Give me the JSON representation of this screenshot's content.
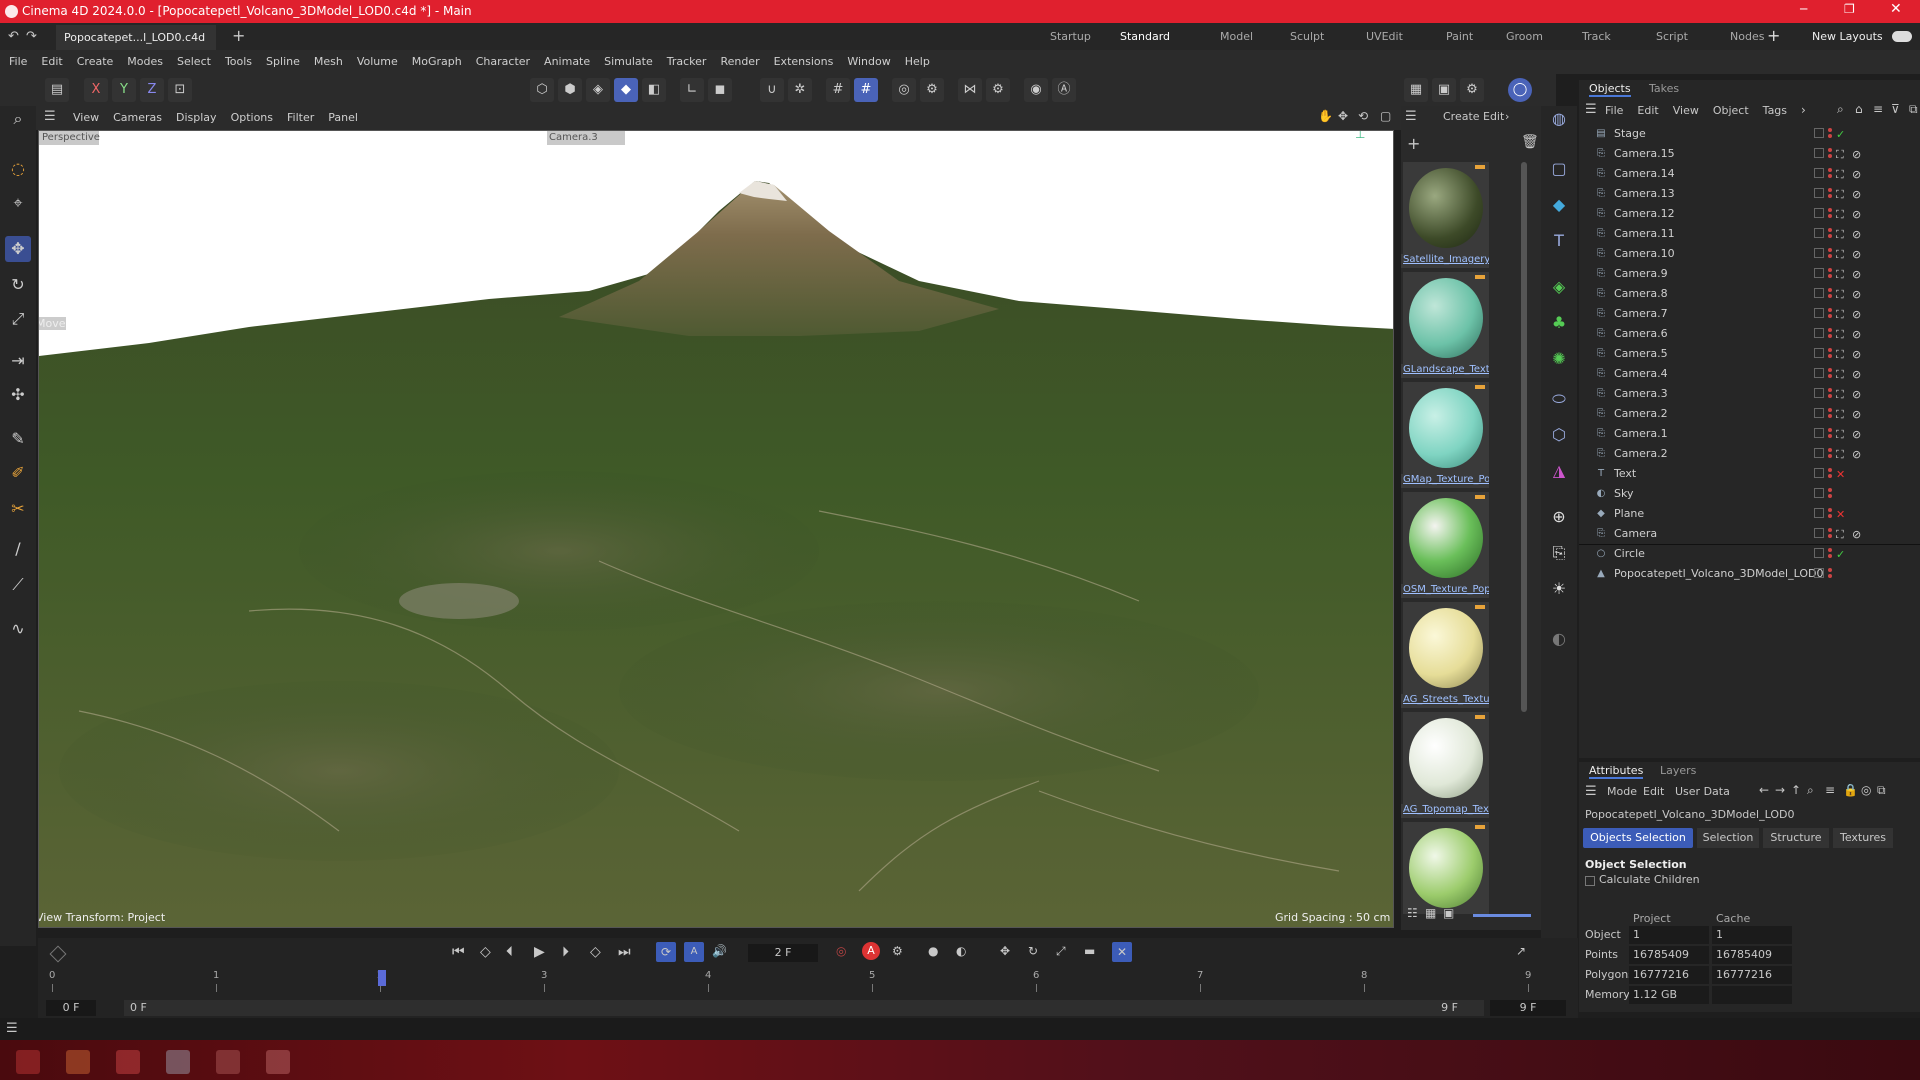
{
  "window": {
    "title": "Cinema 4D 2024.0.0 - [Popocatepetl_Volcano_3DModel_LOD0.c4d *] - Main"
  },
  "doc_tab": {
    "label": "Popocatepet...l_LOD0.c4d *"
  },
  "layouts": [
    "Startup",
    "Standard",
    "Model",
    "Sculpt",
    "UVEdit",
    "Paint",
    "Groom",
    "Track",
    "Script",
    "Nodes"
  ],
  "new_layouts": "New Layouts",
  "menu": [
    "File",
    "Edit",
    "Create",
    "Modes",
    "Select",
    "Tools",
    "Spline",
    "Mesh",
    "Volume",
    "MoGraph",
    "Character",
    "Animate",
    "Simulate",
    "Tracker",
    "Render",
    "Extensions",
    "Window",
    "Help"
  ],
  "axis": {
    "x": "X",
    "y": "Y",
    "z": "Z"
  },
  "viewport": {
    "menu": [
      "View",
      "Cameras",
      "Display",
      "Options",
      "Filter",
      "Panel"
    ],
    "projection": "Perspective",
    "camera": "Camera.3",
    "tool": "Move",
    "transform": "View Transform: Project",
    "grid": "Grid Spacing : 50 cm"
  },
  "materials": {
    "menu": [
      "Create",
      "Edit"
    ],
    "items": [
      "Satellite_Imagery_",
      "GLandscape_Textu",
      "GMap_Texture_Po",
      "OSM_Texture_Pop",
      "AG_Streets_Textur",
      "AG_Topomap_Tex",
      ""
    ]
  },
  "objects": {
    "tabs": [
      "Objects",
      "Takes"
    ],
    "menu": [
      "File",
      "Edit",
      "View",
      "Object",
      "Tags"
    ],
    "items": [
      "Stage",
      "Camera.15",
      "Camera.14",
      "Camera.13",
      "Camera.12",
      "Camera.11",
      "Camera.10",
      "Camera.9",
      "Camera.8",
      "Camera.7",
      "Camera.6",
      "Camera.5",
      "Camera.4",
      "Camera.3",
      "Camera.2",
      "Camera.1",
      "Camera.2",
      "Text",
      "Sky",
      "Plane",
      "Camera",
      "Circle",
      "Popocatepetl_Volcano_3DModel_LOD0"
    ]
  },
  "attributes": {
    "tabs": [
      "Attributes",
      "Layers"
    ],
    "menu": [
      "Mode",
      "Edit",
      "User Data"
    ],
    "object_name": "Popocatepetl_Volcano_3DModel_LOD0",
    "subtabs": [
      "Objects Selection",
      "Selection",
      "Structure",
      "Textures"
    ],
    "section": "Object Selection",
    "calc_children": "Calculate Children",
    "col_project": "Project",
    "col_cache": "Cache",
    "rows": [
      {
        "label": "Object",
        "project": "1",
        "cache": "1"
      },
      {
        "label": "Points",
        "project": "16785409",
        "cache": "16785409"
      },
      {
        "label": "Polygons",
        "project": "16777216",
        "cache": "16777216"
      },
      {
        "label": "Memory",
        "project": "1.12 GB",
        "cache": ""
      }
    ]
  },
  "timeline": {
    "current_frame": "2 F",
    "ticks": [
      "0",
      "1",
      "2",
      "3",
      "4",
      "5",
      "6",
      "7",
      "8",
      "9"
    ],
    "start": "0 F",
    "start2": "0 F",
    "end": "9 F",
    "end2": "9 F"
  }
}
